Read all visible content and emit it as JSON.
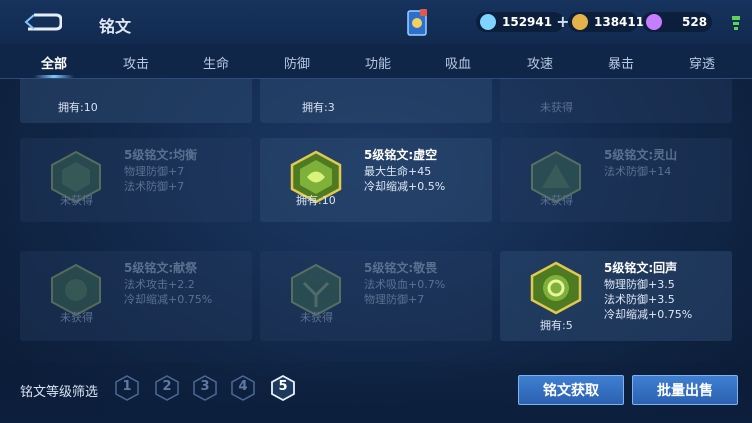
{
  "header": {
    "title": "铭文",
    "currencies": [
      {
        "value": "152941",
        "icon": "blue-gem-icon",
        "color": "#7fd4ff"
      },
      {
        "value": "138411",
        "icon": "gold-coin-icon",
        "color": "#e5b24a"
      },
      {
        "value": "528",
        "icon": "purple-diamond-icon",
        "color": "#c77dff"
      }
    ],
    "plus_label": "+"
  },
  "tabs": [
    {
      "label": "全部",
      "active": true
    },
    {
      "label": "攻击"
    },
    {
      "label": "生命"
    },
    {
      "label": "防御"
    },
    {
      "label": "功能"
    },
    {
      "label": "吸血"
    },
    {
      "label": "攻速"
    },
    {
      "label": "暴击"
    },
    {
      "label": "穿透"
    }
  ],
  "inscriptions": [
    {
      "owned": "拥有:10",
      "obtained": true
    },
    {
      "owned": "拥有:3",
      "obtained": true
    },
    {
      "owned": "未获得",
      "obtained": false
    },
    {
      "name": "5级铭文:均衡",
      "stats": [
        "物理防御+7",
        "法术防御+7"
      ],
      "owned": "未获得",
      "obtained": false
    },
    {
      "name": "5级铭文:虚空",
      "stats": [
        "最大生命+45",
        "冷却缩减+0.5%"
      ],
      "owned": "拥有:10",
      "obtained": true
    },
    {
      "name": "5级铭文:灵山",
      "stats": [
        "法术防御+14"
      ],
      "owned": "未获得",
      "obtained": false
    },
    {
      "name": "5级铭文:献祭",
      "stats": [
        "法术攻击+2.2",
        "冷却缩减+0.75%"
      ],
      "owned": "未获得",
      "obtained": false
    },
    {
      "name": "5级铭文:敬畏",
      "stats": [
        "法术吸血+0.7%",
        "物理防御+7"
      ],
      "owned": "未获得",
      "obtained": false
    },
    {
      "name": "5级铭文:回声",
      "stats": [
        "物理防御+3.5",
        "法术防御+3.5",
        "冷却缩减+0.75%"
      ],
      "owned": "拥有:5",
      "obtained": true
    }
  ],
  "footer": {
    "filter_label": "铭文等级筛选",
    "levels": [
      "1",
      "2",
      "3",
      "4",
      "5"
    ],
    "active_level": "5",
    "obtain_button": "铭文获取",
    "sell_button": "批量出售"
  }
}
